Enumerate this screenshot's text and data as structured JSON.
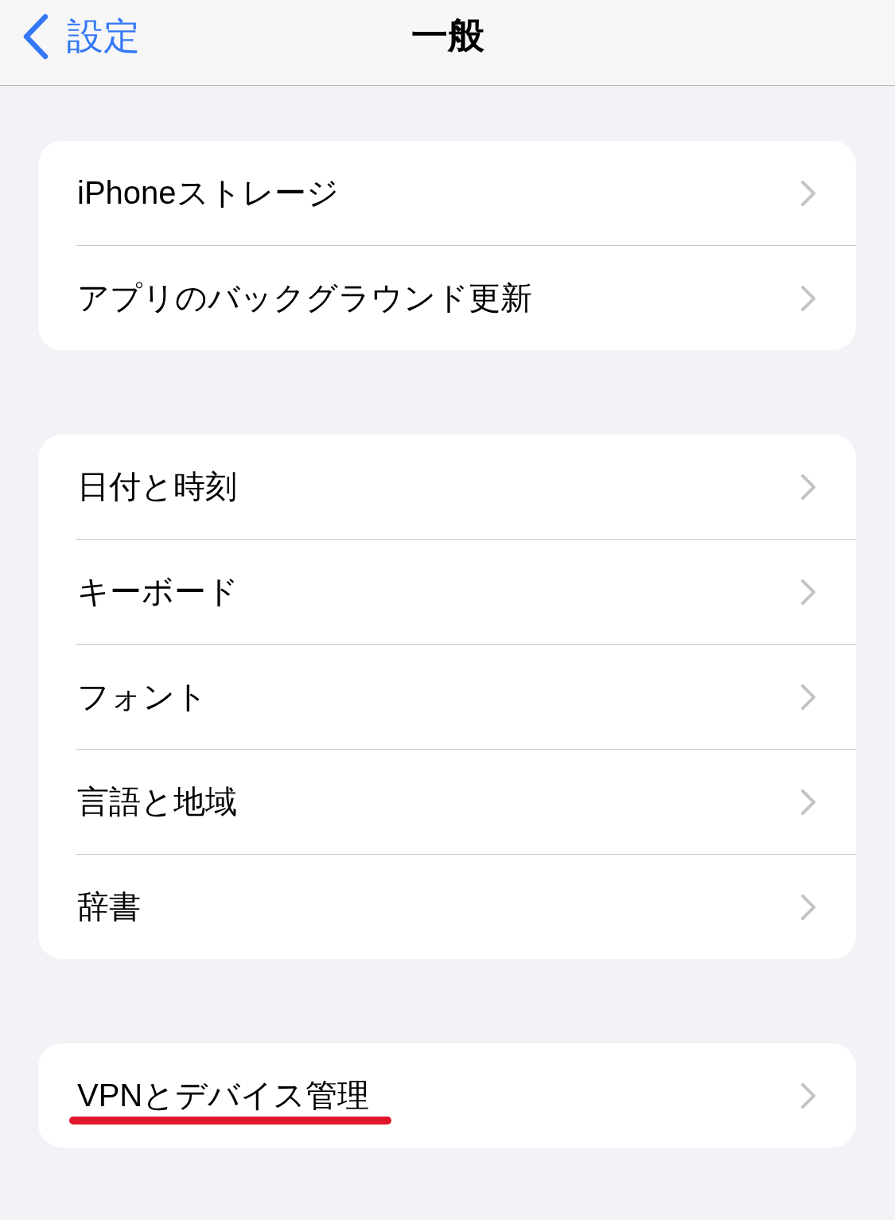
{
  "nav_bar": {
    "back_label": "設定",
    "title": "一般"
  },
  "groups": [
    {
      "items": [
        {
          "label": "iPhoneストレージ",
          "underlined": false
        },
        {
          "label": "アプリのバックグラウンド更新",
          "underlined": false
        }
      ]
    },
    {
      "items": [
        {
          "label": "日付と時刻",
          "underlined": false
        },
        {
          "label": "キーボード",
          "underlined": false
        },
        {
          "label": "フォント",
          "underlined": false
        },
        {
          "label": "言語と地域",
          "underlined": false
        },
        {
          "label": "辞書",
          "underlined": false
        }
      ]
    },
    {
      "items": [
        {
          "label": "VPNとデバイス管理",
          "underlined": true
        }
      ]
    }
  ]
}
